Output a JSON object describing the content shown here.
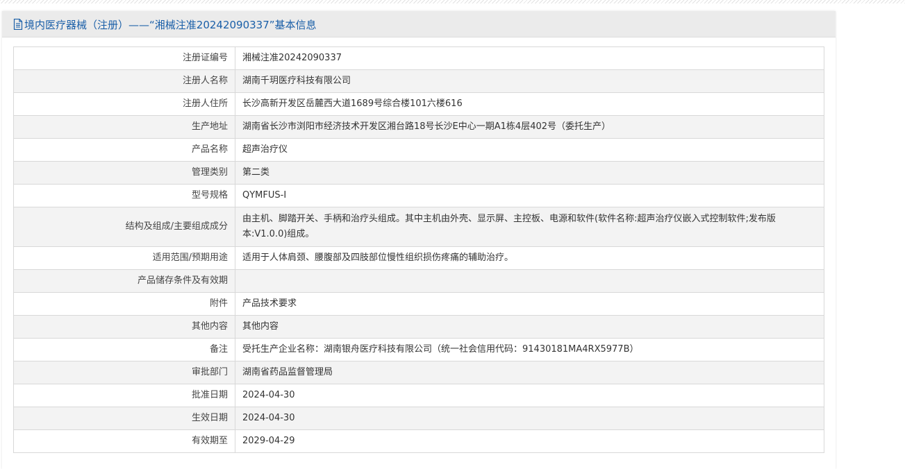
{
  "header": {
    "icon": "document-icon",
    "title": "境内医疗器械（注册）——“湘械注准20242090337”基本信息",
    "title_color": "#1a5fa8"
  },
  "rows": [
    {
      "label": "注册证编号",
      "value": "湘械注准20242090337"
    },
    {
      "label": "注册人名称",
      "value": "湖南千玥医疗科技有限公司"
    },
    {
      "label": "注册人住所",
      "value": "长沙高新开发区岳麓西大道1689号综合楼101六楼616"
    },
    {
      "label": "生产地址",
      "value": "湖南省长沙市浏阳市经济技术开发区湘台路18号长沙E中心一期A1栋4层402号（委托生产）"
    },
    {
      "label": "产品名称",
      "value": "超声治疗仪"
    },
    {
      "label": "管理类别",
      "value": "第二类"
    },
    {
      "label": "型号规格",
      "value": "QYMFUS-I"
    },
    {
      "label": "结构及组成/主要组成成分",
      "value": "由主机、脚踏开关、手柄和治疗头组成。其中主机由外壳、显示屏、主控板、电源和软件(软件名称:超声治疗仪嵌入式控制软件;发布版本:V1.0.0)组成。"
    },
    {
      "label": "适用范围/预期用途",
      "value": "适用于人体肩颈、腰腹部及四肢部位慢性组织损伤疼痛的辅助治疗。"
    },
    {
      "label": "产品储存条件及有效期",
      "value": ""
    },
    {
      "label": "附件",
      "value": "产品技术要求"
    },
    {
      "label": "其他内容",
      "value": "其他内容"
    },
    {
      "label": "备注",
      "value": "受托生产企业名称：湖南银舟医疗科技有限公司（统一社会信用代码：91430181MA4RX5977B）"
    },
    {
      "label": "审批部门",
      "value": "湖南省药品监督管理局"
    },
    {
      "label": "批准日期",
      "value": "2024-04-30"
    },
    {
      "label": "生效日期",
      "value": "2024-04-30"
    },
    {
      "label": "有效期至",
      "value": "2029-04-29"
    }
  ]
}
